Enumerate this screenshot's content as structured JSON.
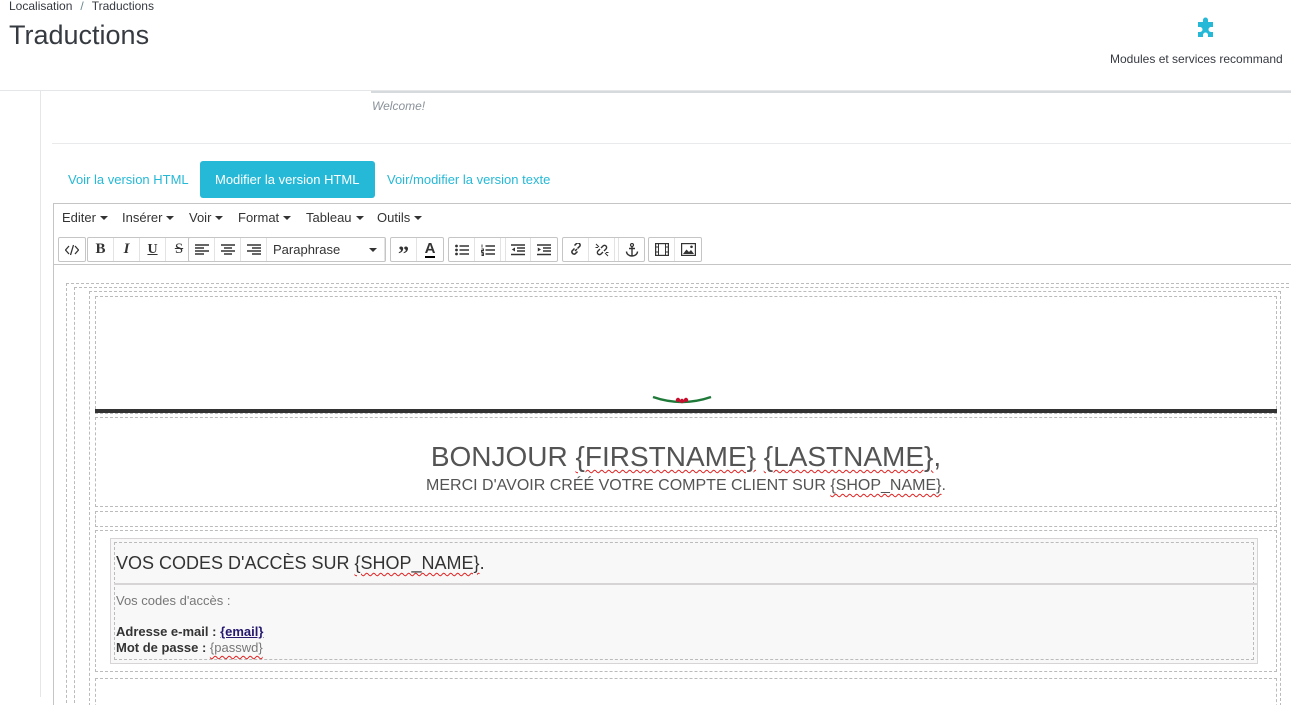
{
  "header": {
    "breadcrumb": [
      "Localisation",
      "Traductions"
    ],
    "breadcrumb_sep": "/",
    "title": "Traductions",
    "toolbar_button": {
      "label": "Modules et services recommand",
      "icon": "puzzle-icon"
    }
  },
  "subject": {
    "value": "Welcome!"
  },
  "tabs": [
    {
      "label": "Voir la version HTML",
      "active": false
    },
    {
      "label": "Modifier la version HTML",
      "active": true
    },
    {
      "label": "Voir/modifier la version texte",
      "active": false
    }
  ],
  "editor": {
    "menus": [
      "Editer",
      "Insérer",
      "Voir",
      "Format",
      "Tableau",
      "Outils"
    ],
    "block_format": "Paraphrase"
  },
  "email": {
    "greeting_text": "BONJOUR",
    "greeting_first": "{FIRSTNAME}",
    "greeting_last": "{LASTNAME}",
    "greeting_end": ",",
    "sub_text": "MERCI D'AVOIR CRÉÉ VOTRE COMPTE CLIENT SUR",
    "sub_var": "{SHOP_NAME}",
    "sub_end": ".",
    "box_title_text": "VOS CODES D'ACCÈS SUR",
    "box_title_var": "{SHOP_NAME}",
    "box_title_end": ".",
    "codes_label": "Vos codes d'accès :",
    "email_label": "Adresse e-mail :",
    "email_value": "{email}",
    "password_label": "Mot de passe :",
    "password_value": "{passwd}"
  },
  "colors": {
    "accent": "#25b9d7",
    "text": "#363a41",
    "email_text": "#555454"
  }
}
